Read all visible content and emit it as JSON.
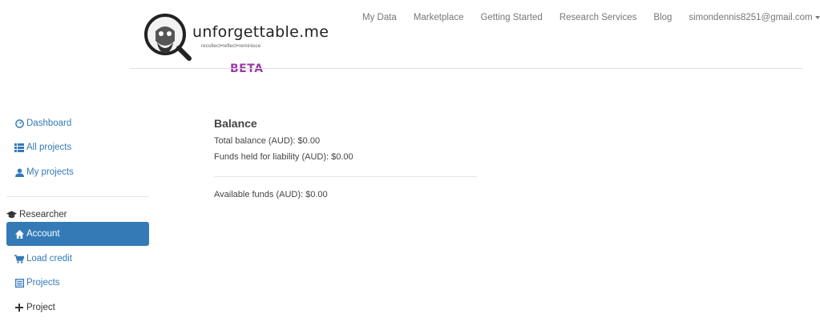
{
  "brand": {
    "wordmark": "unforgettable.me",
    "tagline": "recollect•reflect•reminisce",
    "badge": "BETA"
  },
  "topnav": {
    "links": [
      "My Data",
      "Marketplace",
      "Getting Started",
      "Research Services",
      "Blog"
    ],
    "user": "simondennis8251@gmail.com"
  },
  "sidebar": {
    "general": [
      {
        "label": "Dashboard",
        "icon": "dashboard-icon"
      },
      {
        "label": "All projects",
        "icon": "list-icon"
      },
      {
        "label": "My projects",
        "icon": "user-icon"
      }
    ],
    "section_title": "Researcher",
    "section_icon": "graduation-cap-icon",
    "researcher": [
      {
        "label": "Account",
        "icon": "home-icon",
        "active": true
      },
      {
        "label": "Load credit",
        "icon": "cart-icon"
      },
      {
        "label": "Projects",
        "icon": "list-alt-icon"
      },
      {
        "label": "Project",
        "icon": "plus-icon"
      }
    ]
  },
  "main": {
    "title": "Balance",
    "total_balance": "Total balance (AUD): $0.00",
    "funds_held": "Funds held for liability (AUD): $0.00",
    "available": "Available funds (AUD): $0.00"
  },
  "colors": {
    "accent": "#337ab7",
    "beta": "#9b3aa6",
    "nav_text": "#777777"
  }
}
